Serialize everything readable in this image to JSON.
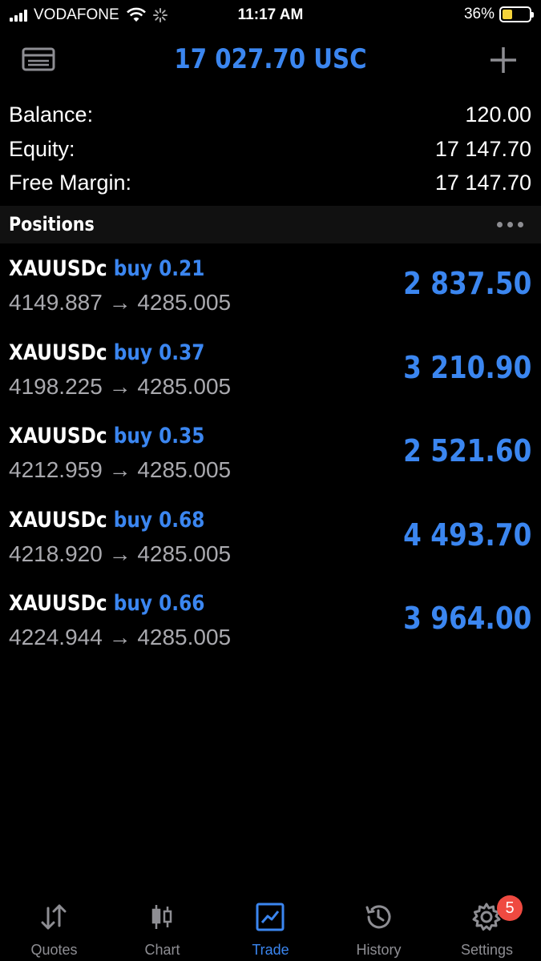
{
  "status_bar": {
    "carrier": "VODAFONE",
    "time": "11:17 AM",
    "battery_percent": "36%",
    "battery_level": 0.36
  },
  "header": {
    "title": "17 027.70 USC",
    "left_icon": "wallet-icon",
    "right_icon": "plus-icon"
  },
  "summary": [
    {
      "label": "Balance:",
      "value": "120.00"
    },
    {
      "label": "Equity:",
      "value": "17 147.70"
    },
    {
      "label": "Free Margin:",
      "value": "17 147.70"
    }
  ],
  "positions_section": {
    "title": "Positions",
    "menu_icon": "more-icon"
  },
  "positions": [
    {
      "symbol": "XAUUSDc",
      "side": "buy 0.21",
      "prices": "4149.887 → 4285.005",
      "profit": "2 837.50"
    },
    {
      "symbol": "XAUUSDc",
      "side": "buy 0.37",
      "prices": "4198.225 → 4285.005",
      "profit": "3 210.90"
    },
    {
      "symbol": "XAUUSDc",
      "side": "buy 0.35",
      "prices": "4212.959 → 4285.005",
      "profit": "2 521.60"
    },
    {
      "symbol": "XAUUSDc",
      "side": "buy 0.68",
      "prices": "4218.920 → 4285.005",
      "profit": "4 493.70"
    },
    {
      "symbol": "XAUUSDc",
      "side": "buy 0.66",
      "prices": "4224.944 → 4285.005",
      "profit": "3 964.00"
    }
  ],
  "tabs": [
    {
      "label": "Quotes",
      "icon": "quotes-icon"
    },
    {
      "label": "Chart",
      "icon": "chart-icon"
    },
    {
      "label": "Trade",
      "icon": "trade-icon",
      "active": true
    },
    {
      "label": "History",
      "icon": "history-icon"
    },
    {
      "label": "Settings",
      "icon": "settings-icon"
    }
  ],
  "settings_badge": "5",
  "colors": {
    "accent": "#3b86f0",
    "background": "#000000",
    "secondary_text": "#a9a9ae",
    "badge": "#ef4a41"
  }
}
